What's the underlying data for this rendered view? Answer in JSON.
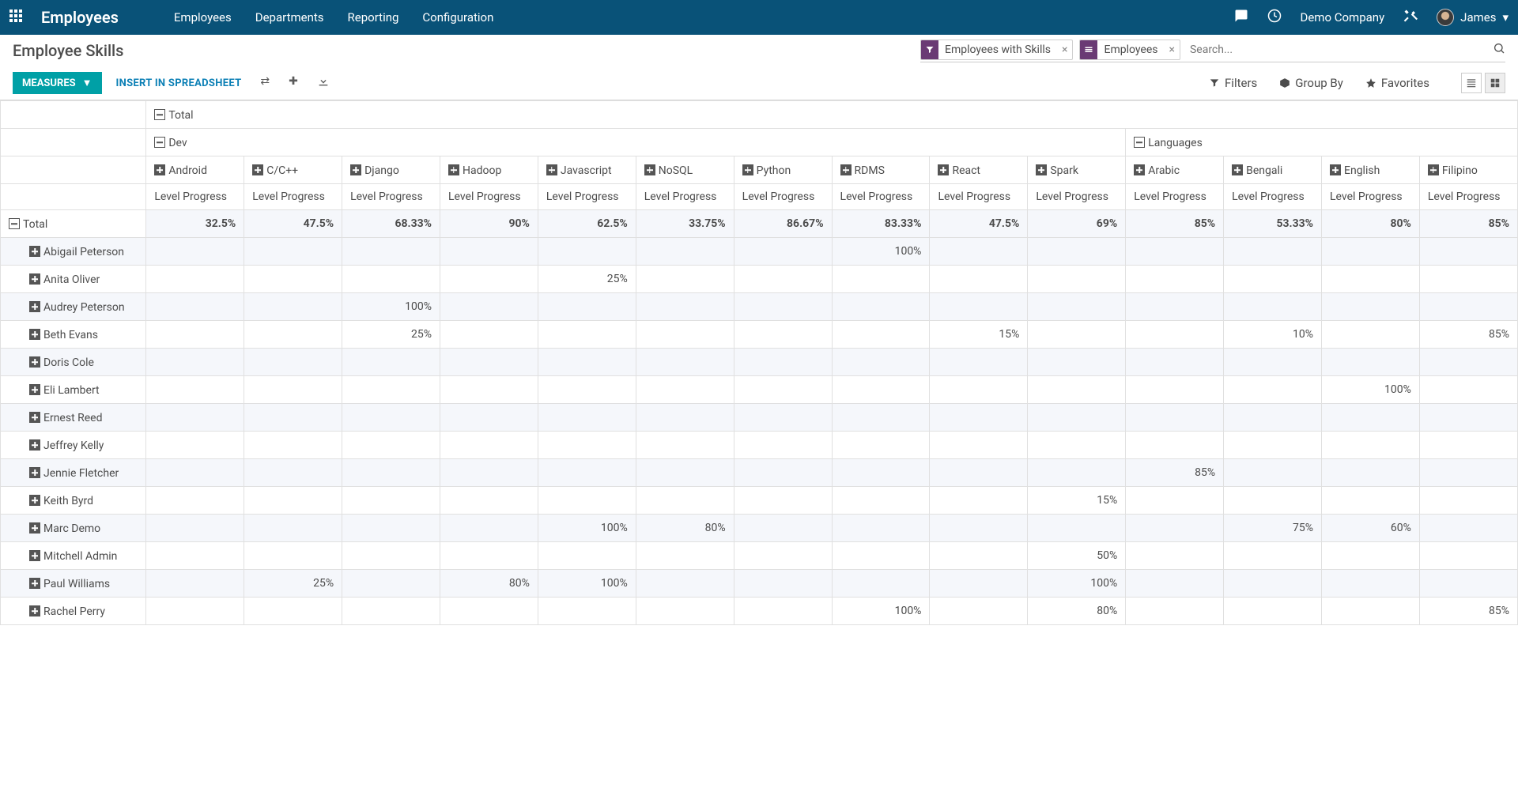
{
  "header": {
    "brand": "Employees",
    "menu": [
      "Employees",
      "Departments",
      "Reporting",
      "Configuration"
    ],
    "company": "Demo Company",
    "user": "James"
  },
  "title": "Employee Skills",
  "search": {
    "filter_pill": "Employees with Skills",
    "groupby_pill": "Employees",
    "placeholder": "Search..."
  },
  "toolbar": {
    "measures": "MEASURES",
    "insert": "INSERT IN SPREADSHEET",
    "filters": "Filters",
    "groupby": "Group By",
    "favorites": "Favorites"
  },
  "pivot": {
    "total_label": "Total",
    "measure_label": "Level Progress",
    "groups": [
      {
        "name": "Dev",
        "skills": [
          "Android",
          "C/C++",
          "Django",
          "Hadoop",
          "Javascript",
          "NoSQL",
          "Python",
          "RDMS",
          "React",
          "Spark"
        ]
      },
      {
        "name": "Languages",
        "skills": [
          "Arabic",
          "Bengali",
          "English",
          "Filipino"
        ]
      }
    ],
    "totals": [
      "32.5%",
      "47.5%",
      "68.33%",
      "90%",
      "62.5%",
      "33.75%",
      "86.67%",
      "83.33%",
      "47.5%",
      "69%",
      "85%",
      "53.33%",
      "80%",
      "85%"
    ],
    "rows": [
      {
        "name": "Abigail Peterson",
        "vals": [
          "",
          "",
          "",
          "",
          "",
          "",
          "",
          "100%",
          "",
          "",
          "",
          "",
          "",
          ""
        ]
      },
      {
        "name": "Anita Oliver",
        "vals": [
          "",
          "",
          "",
          "",
          "25%",
          "",
          "",
          "",
          "",
          "",
          "",
          "",
          "",
          ""
        ]
      },
      {
        "name": "Audrey Peterson",
        "vals": [
          "",
          "",
          "100%",
          "",
          "",
          "",
          "",
          "",
          "",
          "",
          "",
          "",
          "",
          ""
        ]
      },
      {
        "name": "Beth Evans",
        "vals": [
          "",
          "",
          "25%",
          "",
          "",
          "",
          "",
          "",
          "15%",
          "",
          "",
          "10%",
          "",
          "85%"
        ]
      },
      {
        "name": "Doris Cole",
        "vals": [
          "",
          "",
          "",
          "",
          "",
          "",
          "",
          "",
          "",
          "",
          "",
          "",
          "",
          ""
        ]
      },
      {
        "name": "Eli Lambert",
        "vals": [
          "",
          "",
          "",
          "",
          "",
          "",
          "",
          "",
          "",
          "",
          "",
          "",
          "100%",
          ""
        ]
      },
      {
        "name": "Ernest Reed",
        "vals": [
          "",
          "",
          "",
          "",
          "",
          "",
          "",
          "",
          "",
          "",
          "",
          "",
          "",
          ""
        ]
      },
      {
        "name": "Jeffrey Kelly",
        "vals": [
          "",
          "",
          "",
          "",
          "",
          "",
          "",
          "",
          "",
          "",
          "",
          "",
          "",
          ""
        ]
      },
      {
        "name": "Jennie Fletcher",
        "vals": [
          "",
          "",
          "",
          "",
          "",
          "",
          "",
          "",
          "",
          "",
          "85%",
          "",
          "",
          ""
        ]
      },
      {
        "name": "Keith Byrd",
        "vals": [
          "",
          "",
          "",
          "",
          "",
          "",
          "",
          "",
          "",
          "15%",
          "",
          "",
          "",
          ""
        ]
      },
      {
        "name": "Marc Demo",
        "vals": [
          "",
          "",
          "",
          "",
          "100%",
          "80%",
          "",
          "",
          "",
          "",
          "",
          "75%",
          "60%",
          ""
        ]
      },
      {
        "name": "Mitchell Admin",
        "vals": [
          "",
          "",
          "",
          "",
          "",
          "",
          "",
          "",
          "",
          "50%",
          "",
          "",
          "",
          ""
        ]
      },
      {
        "name": "Paul Williams",
        "vals": [
          "",
          "25%",
          "",
          "80%",
          "100%",
          "",
          "",
          "",
          "",
          "100%",
          "",
          "",
          "",
          ""
        ]
      },
      {
        "name": "Rachel Perry",
        "vals": [
          "",
          "",
          "",
          "",
          "",
          "",
          "",
          "100%",
          "",
          "80%",
          "",
          "",
          "",
          "85%"
        ]
      }
    ]
  }
}
